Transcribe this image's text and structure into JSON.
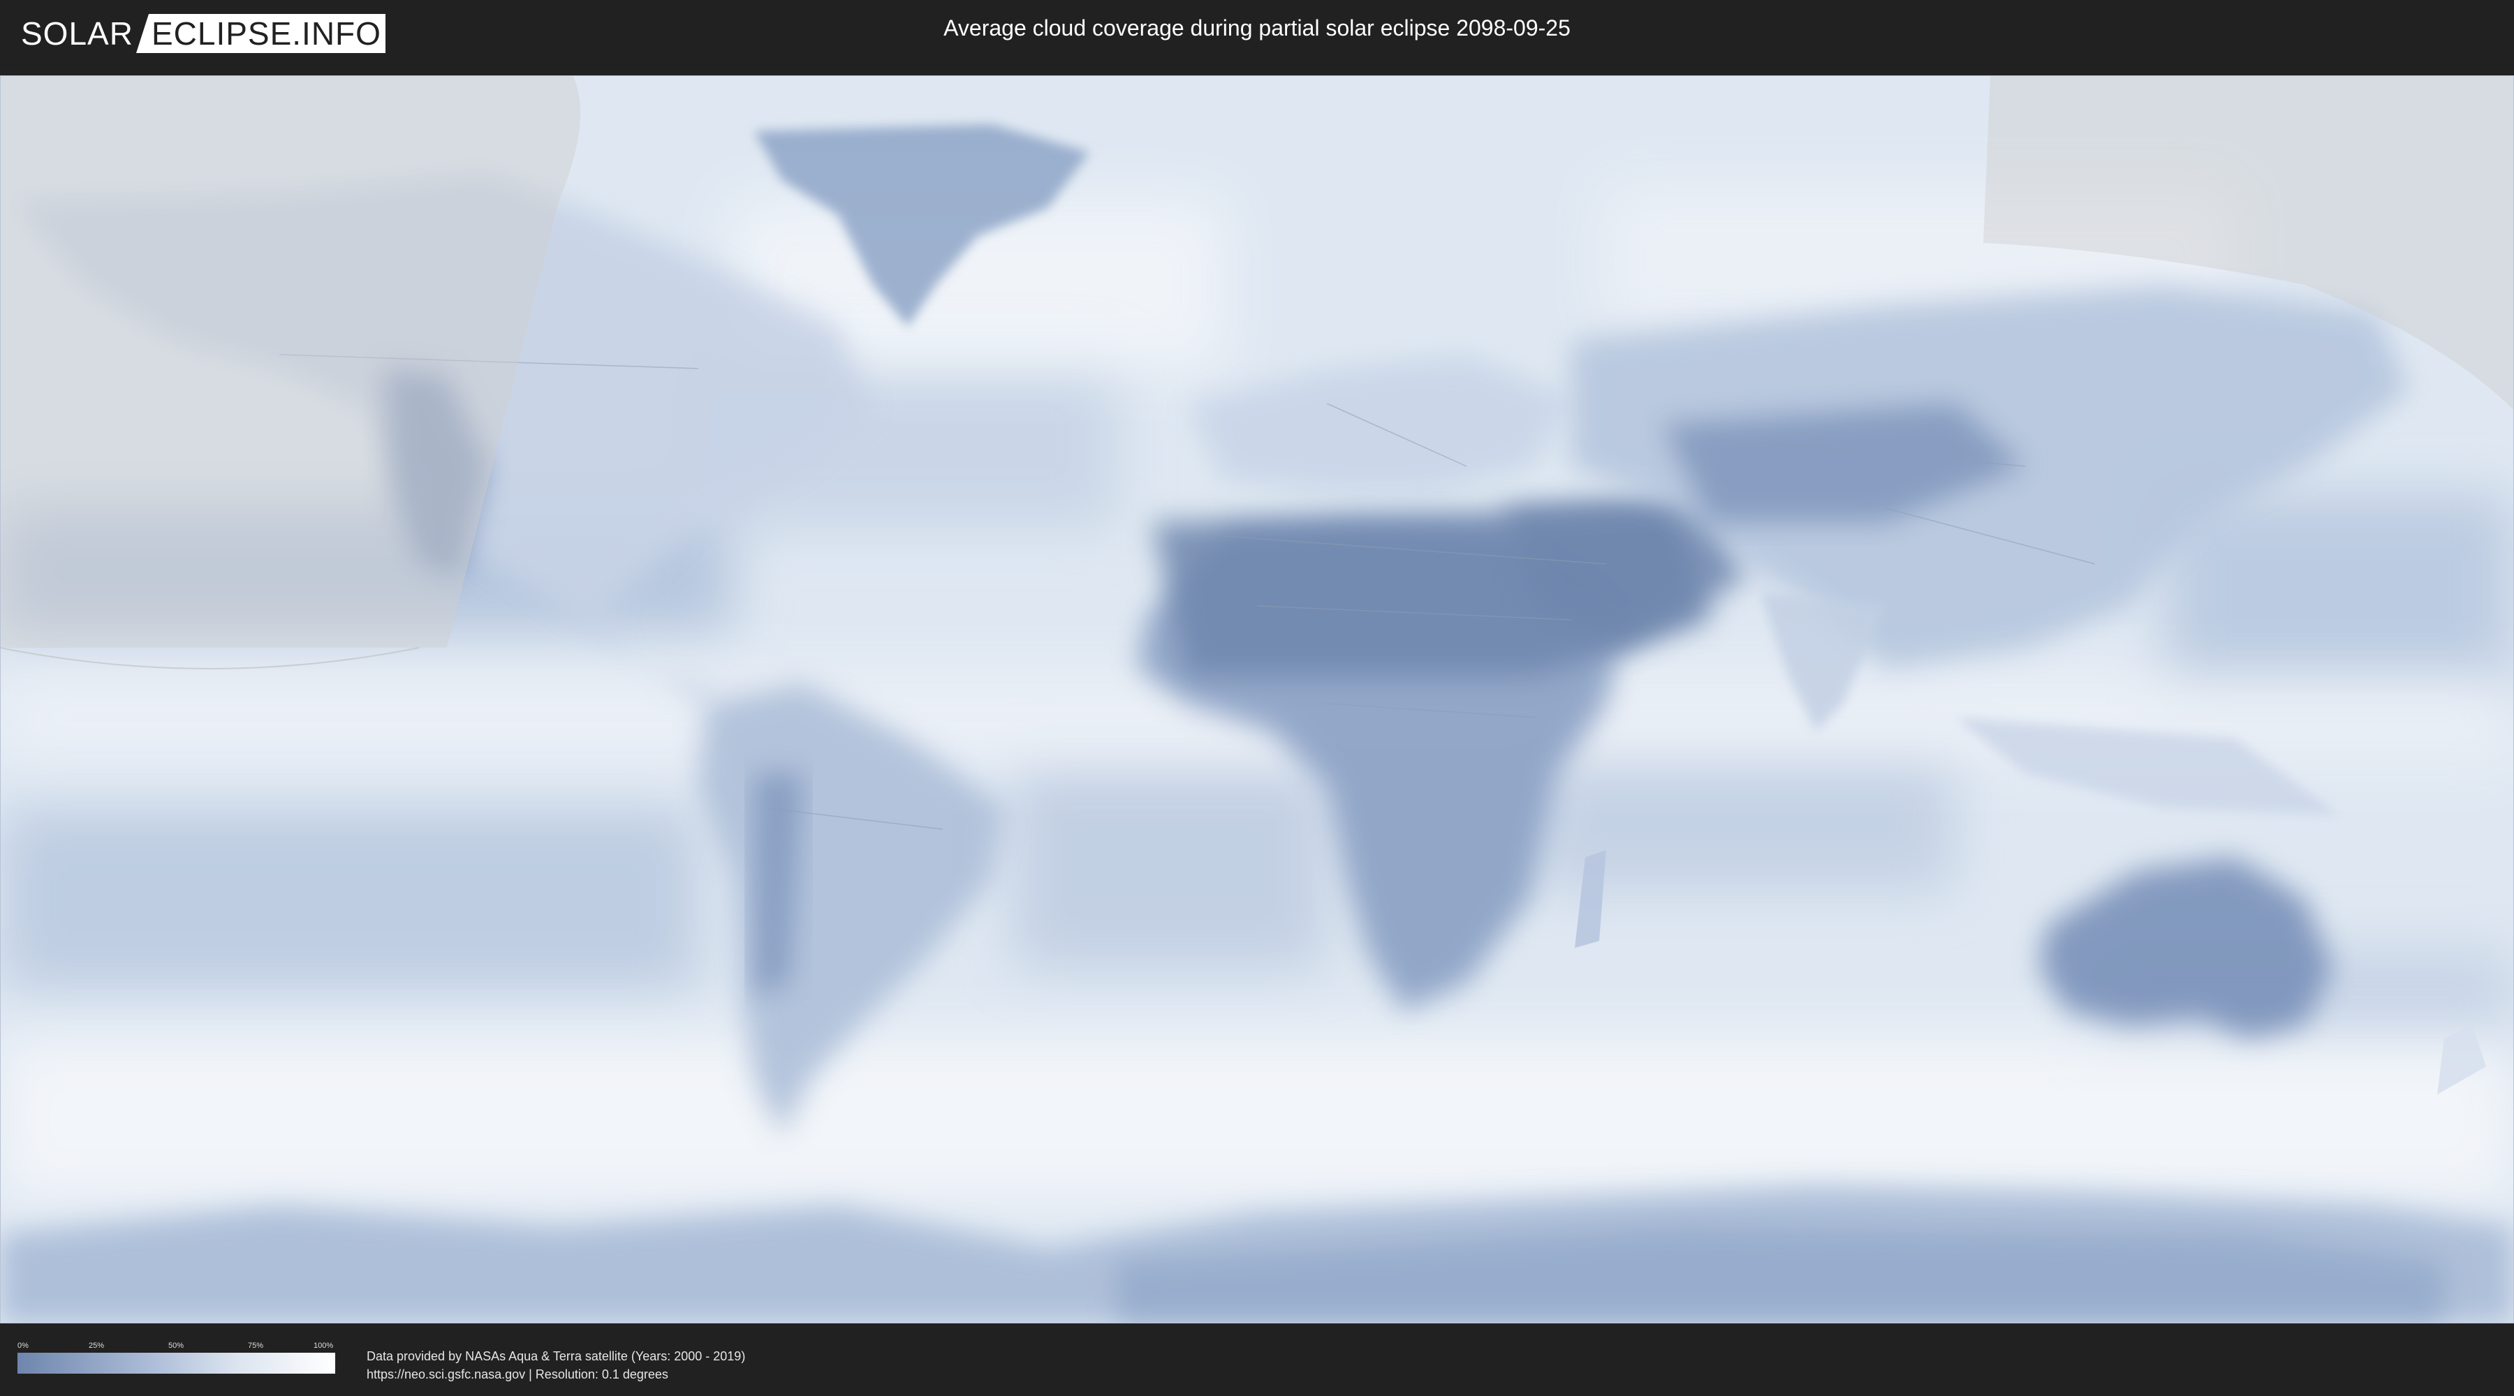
{
  "header": {
    "logo_left": "SOLAR",
    "logo_right": "ECLIPSE.INFO",
    "title": "Average cloud coverage during partial solar eclipse 2098-09-25"
  },
  "legend": {
    "ticks": [
      "0%",
      "25%",
      "50%",
      "75%",
      "100%"
    ],
    "colors": {
      "low": "#6e86ad",
      "mid": "#a9bad6",
      "high": "#ffffff"
    }
  },
  "footer": {
    "credit_line1": "Data provided by NASAs Aqua & Terra satellite (Years: 2000 - 2019)",
    "credit_line2": "https://neo.sci.gsfc.nasa.gov | Resolution: 0.1 degrees"
  },
  "map": {
    "projection": "equirectangular",
    "ocean_color": "#dfe8f2",
    "clear_sky_color": "#6e86ad",
    "cloud_color": "#ffffff",
    "eclipse_region_color": "#cfcfcf"
  }
}
